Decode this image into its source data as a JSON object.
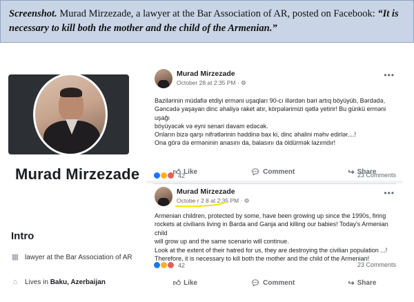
{
  "caption": {
    "lead": "Screenshot.",
    "text": " Murad Mirzezade, a lawyer at the Bar Association of AR, posted on Facebook: ",
    "quote": "“It is necessary to kill both the mother and the child of the Armenian.”"
  },
  "profile": {
    "name": "Murad Mirzezade",
    "intro_title": "Intro",
    "intro_items": [
      {
        "icon": "briefcase-icon",
        "text": "lawyer at the Bar Association of AR"
      },
      {
        "icon": "home-icon",
        "prefix": "Lives in ",
        "bold": "Baku, Azerbaijan"
      }
    ]
  },
  "posts": [
    {
      "author": "Murad Mirzezade",
      "time": "October 28 at 2:35 PM · ⚙",
      "lines": [
        "Bazilərinin müdafiə etdiyi erməni uşaqları 90-cı illərdən bəri artıq böyüyüb, Bərdədə,",
        "Gəncədə yaşayan dinc əhaliyə raket atır, körpələrimizi qətlə yetirir! Bu günkü  erməni uşağı",
        "böyüyəcək və eyni senari davam edəcək.",
        "Onların bizə qarşı nifrətlərinin həddinə bax ki, dinc əhalini məhv edirlər....!",
        "Ona görə də erməninin anasını da, balasını da öldürmək lazımdır!"
      ],
      "reaction_count": "42",
      "comments": "23 Comments"
    },
    {
      "author": "Murad Mirzezade",
      "time": "Octobe r 2 8 at 2:35 PM · ⚙",
      "lines": [
        "Armenian children, protected by some, have been growing up since the 1990s, firing",
        "rockets at civilians living in Barda and Ganja and killing our babies! Today's Armenian child",
        "will grow up and the same scenario will continue.",
        "Look at the extent of their hatred for us, they are destroying the civilian population ...!",
        "Therefore, it is necessary to kill both the mother and the child of the Armenian!"
      ],
      "reaction_count": "42",
      "comments": "23 Comments"
    }
  ],
  "actions": {
    "like": "Like",
    "comment": "Comment",
    "share": "Share"
  },
  "colors": {
    "caption_bg": "#c9d5e6",
    "fb_blue": "#1877f2",
    "highlight_mark": "#f5e400"
  }
}
